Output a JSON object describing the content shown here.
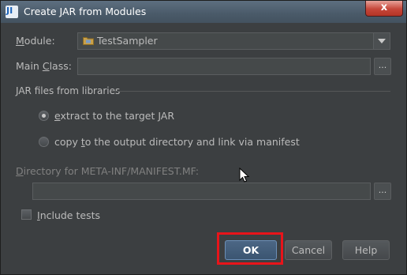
{
  "window": {
    "title": "Create JAR from Modules",
    "app_icon_glyph": "JI",
    "close_glyph": "x"
  },
  "form": {
    "module_label": "Module:",
    "module_value": "TestSampler",
    "main_class_label": "Main Class:",
    "main_class_value": "",
    "browse_glyph": "...",
    "libraries_section_label": "JAR files from libraries",
    "option_extract_label": "extract to the target JAR",
    "option_copy_label": "copy to the output directory and link via manifest",
    "option_extract_selected": true,
    "manifest_dir_label": "Directory for META-INF/MANIFEST.MF:",
    "manifest_dir_value": "",
    "include_tests_label": "Include tests",
    "include_tests_checked": false
  },
  "buttons": {
    "ok": "OK",
    "cancel": "Cancel",
    "help": "Help"
  },
  "annotation": {
    "highlight_color": "#e8141a",
    "highlight_target": "OK"
  },
  "icons": [
    "app-icon",
    "close-icon",
    "folder-icon",
    "chevron-down-icon",
    "mouse-cursor-icon"
  ]
}
